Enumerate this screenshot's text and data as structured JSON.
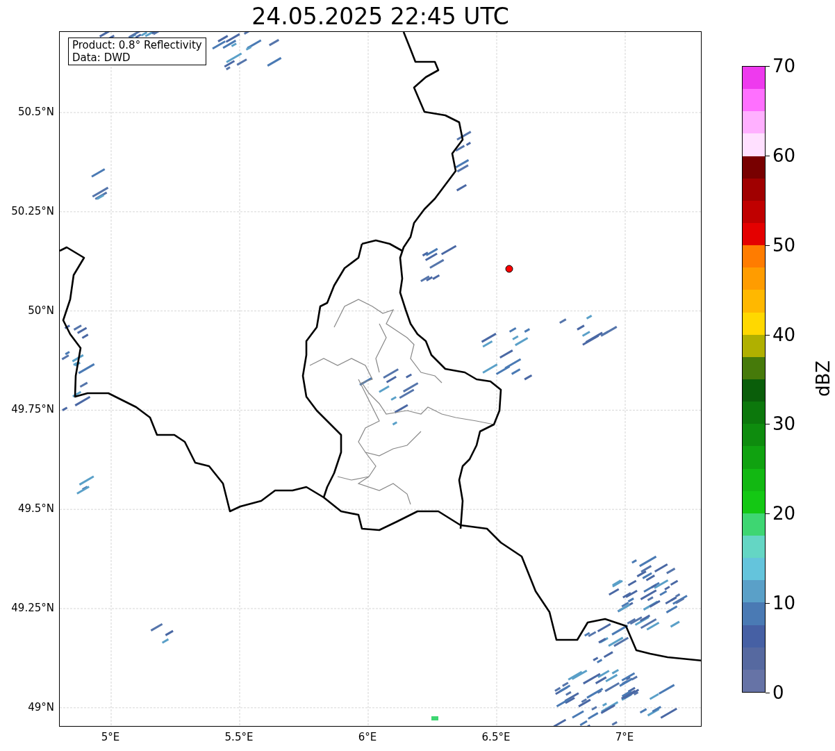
{
  "title": "24.05.2025 22:45 UTC",
  "info_box": [
    "Product: 0.8° Reflectivity",
    "Data: DWD"
  ],
  "y_axis": {
    "ticks": [
      "50.5°N",
      "50.25°N",
      "50°N",
      "49.75°N",
      "49.5°N",
      "49.25°N",
      "49°N"
    ]
  },
  "x_axis": {
    "ticks": [
      "5°E",
      "5.5°E",
      "6°E",
      "6.5°E",
      "7°E"
    ]
  },
  "colorbar": {
    "label": "dBZ",
    "ticks": [
      "70",
      "60",
      "50",
      "40",
      "30",
      "20",
      "10",
      "0"
    ],
    "bands": [
      {
        "color": "#6673a6"
      },
      {
        "color": "#5669a0"
      },
      {
        "color": "#4660a4"
      },
      {
        "color": "#4a7ab4"
      },
      {
        "color": "#5aa0c8"
      },
      {
        "color": "#64c4dc"
      },
      {
        "color": "#64d6c4"
      },
      {
        "color": "#3ed672"
      },
      {
        "color": "#14c814"
      },
      {
        "color": "#12b812"
      },
      {
        "color": "#10a210"
      },
      {
        "color": "#0e8c0e"
      },
      {
        "color": "#0c780c"
      },
      {
        "color": "#0a5e0a"
      },
      {
        "color": "#467a0a"
      },
      {
        "color": "#b0b000"
      },
      {
        "color": "#ffd800"
      },
      {
        "color": "#ffb800"
      },
      {
        "color": "#ff9c00"
      },
      {
        "color": "#ff7c00"
      },
      {
        "color": "#e40000"
      },
      {
        "color": "#c00000"
      },
      {
        "color": "#a00000"
      },
      {
        "color": "#780000"
      },
      {
        "color": "#ffe0ff"
      },
      {
        "color": "#ffb0ff"
      },
      {
        "color": "#ff70ff"
      },
      {
        "color": "#ee3aee"
      }
    ]
  }
}
